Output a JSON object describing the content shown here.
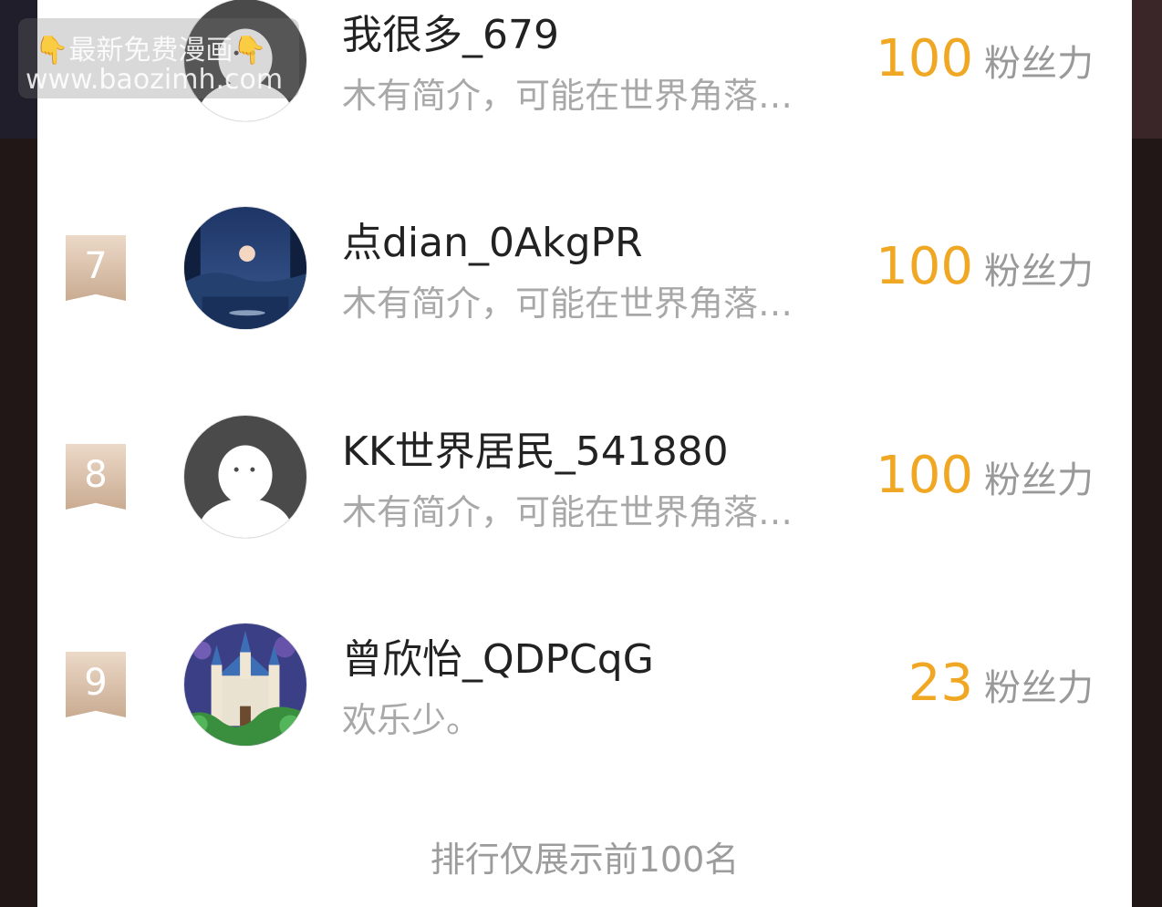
{
  "watermark": {
    "line1": "👇最新免费漫画👇",
    "line2": "www.baozimh.com"
  },
  "rows": [
    {
      "rank": "",
      "name": "我很多_679",
      "bio": "木有简介，可能在世界角落…",
      "score": "100",
      "unit": "粉丝力",
      "avatar": "default-avatar"
    },
    {
      "rank": "7",
      "name": "点dian_0AkgPR",
      "bio": "木有简介，可能在世界角落…",
      "score": "100",
      "unit": "粉丝力",
      "avatar": "moon-avatar"
    },
    {
      "rank": "8",
      "name": "KK世界居民_541880",
      "bio": "木有简介，可能在世界角落…",
      "score": "100",
      "unit": "粉丝力",
      "avatar": "default-avatar"
    },
    {
      "rank": "9",
      "name": "曾欣怡_QDPCqG",
      "bio": "欢乐少。",
      "score": "23",
      "unit": "粉丝力",
      "avatar": "castle-avatar"
    }
  ],
  "footer": "排行仅展示前100名",
  "colors": {
    "accent": "#f0a824",
    "badge": "#d7bda6",
    "muted": "#a8a8a8"
  }
}
